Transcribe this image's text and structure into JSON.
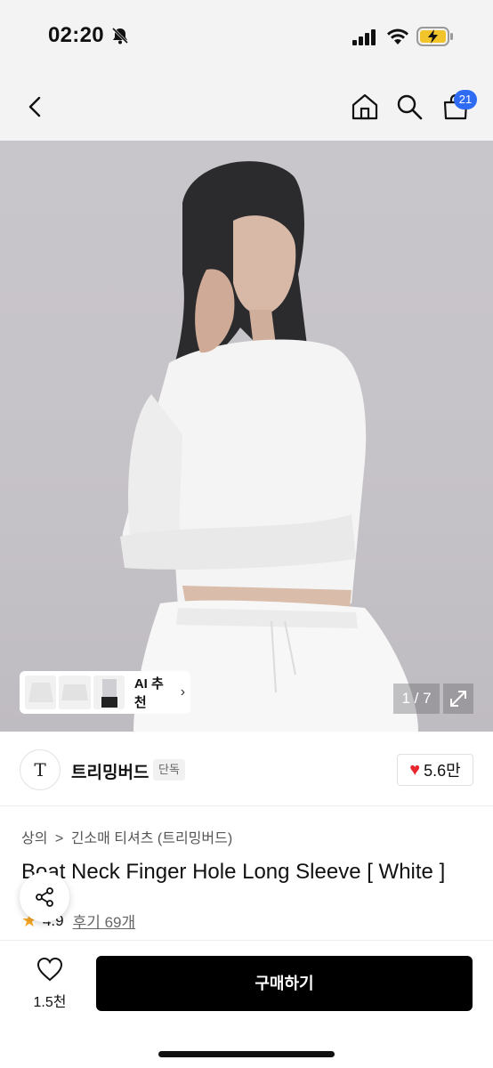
{
  "status": {
    "time": "02:20",
    "icons": [
      "bell-slash-icon",
      "cellular-signal-icon",
      "wifi-icon",
      "battery-charging-icon"
    ]
  },
  "nav": {
    "cart_count": "21",
    "icons": [
      "chevron-left-icon",
      "home-icon",
      "search-icon",
      "shopping-bag-icon"
    ]
  },
  "gallery": {
    "ai_label": "AI 추천",
    "page_indicator": "1 / 7"
  },
  "brand": {
    "logo_text": "T",
    "name": "트리밍버드",
    "badge": "단독",
    "likes": "5.6만"
  },
  "product": {
    "breadcrumb": [
      "상의",
      ">",
      "긴소매 티셔츠 (트리밍버드)"
    ],
    "title": "Boat Neck Finger Hole Long Sleeve [ White ]",
    "rating": "4.9",
    "review_link": "후기 69개"
  },
  "bottom": {
    "wish_count": "1.5천",
    "buy_label": "구매하기"
  },
  "colors": {
    "accent_blue": "#2f6cf6",
    "heart_red": "#e8262d",
    "star_yellow": "#f5a623",
    "buy_button": "#000000"
  }
}
